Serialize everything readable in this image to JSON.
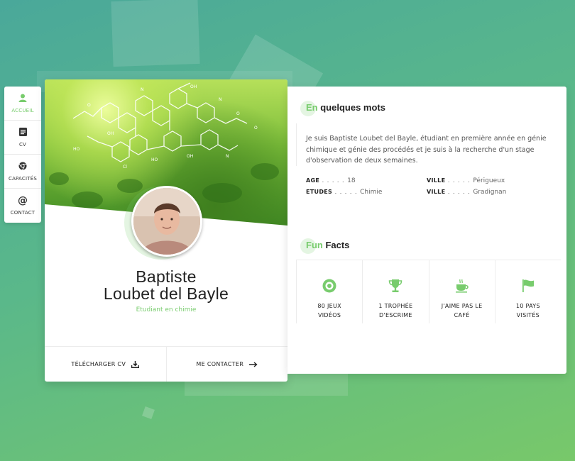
{
  "menu": {
    "items": [
      {
        "label": "ACCUEIL",
        "icon": "user-icon"
      },
      {
        "label": "CV",
        "icon": "document-icon"
      },
      {
        "label": "CAPACITÉS",
        "icon": "chrome-icon"
      },
      {
        "label": "CONTACT",
        "icon": "at-icon"
      }
    ],
    "active": "ACCUEIL"
  },
  "profile": {
    "first_line": "Baptiste",
    "second_line": "Loubet del Bayle",
    "role": "Etudiant en chimie",
    "download_label": "TÉLÉCHARGER CV",
    "contact_label": "ME CONTACTER"
  },
  "about": {
    "title_accent": "En",
    "title_rest": " quelques mots",
    "intro": "Je suis Baptiste Loubet del Bayle, étudiant en première année en génie chimique et génie des procédés et je suis à la recherche d'un stage d'observation de deux semaines.",
    "info": [
      {
        "key": "AGE",
        "dots": " . . . . . ",
        "value": "18"
      },
      {
        "key": "VILLE",
        "dots": " . . . . . ",
        "value": "Périgueux"
      },
      {
        "key": "ETUDES",
        "dots": " . . . . . ",
        "value": "Chimie"
      },
      {
        "key": "VILLE",
        "dots": " . . . . . ",
        "value": "Gradignan"
      }
    ]
  },
  "facts": {
    "title_accent": "Fun",
    "title_rest": " Facts",
    "items": [
      {
        "line1": "80 JEUX",
        "line2": "VIDÉOS",
        "icon": "target-icon"
      },
      {
        "line1": "1 TROPHÉE",
        "line2": "D'ESCRIME",
        "icon": "trophy-icon"
      },
      {
        "line1": "J'AIME PAS LE",
        "line2": "CAFÉ",
        "icon": "coffee-icon"
      },
      {
        "line1": "10 PAYS",
        "line2": "VISITÉS",
        "icon": "flag-icon"
      }
    ]
  },
  "colors": {
    "accent": "#78cc6d",
    "text": "#222222"
  }
}
